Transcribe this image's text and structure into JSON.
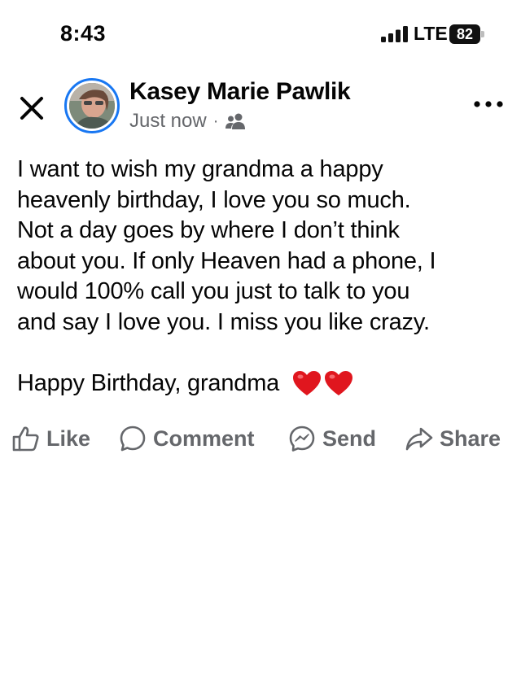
{
  "status_bar": {
    "time": "8:43",
    "network": "LTE",
    "battery_level": "82"
  },
  "post": {
    "author": "Kasey Marie Pawlik",
    "timestamp": "Just now",
    "separator": "·",
    "audience_icon": "friends-icon",
    "body_lines": [
      "I want to wish my grandma a happy",
      "heavenly birthday, I love you so much.",
      "Not a day goes by where I don’t think",
      "about you. If only Heaven had a phone, I",
      "would 100% call you just to talk to you",
      "and say I love you. I miss you like crazy."
    ],
    "closing_line": "Happy Birthday, grandma",
    "closing_emoji": "❤️❤️"
  },
  "actions": {
    "like": "Like",
    "comment": "Comment",
    "send": "Send",
    "share": "Share"
  },
  "colors": {
    "accent": "#1877f2",
    "muted_text": "#65676b",
    "heart": "#e0161e"
  }
}
